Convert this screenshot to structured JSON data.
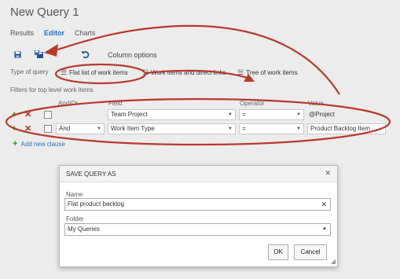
{
  "window": {
    "title": "New Query 1"
  },
  "tabs": [
    {
      "label": "Results"
    },
    {
      "label": "Editor",
      "active": true
    },
    {
      "label": "Charts"
    }
  ],
  "toolbar": {
    "column_options_label": "Column options"
  },
  "query_type": {
    "label": "Type of query",
    "options": [
      {
        "label": "Flat list of work items",
        "selected": true
      },
      {
        "label": "Work items and direct links"
      },
      {
        "label": "Tree of work items"
      }
    ]
  },
  "filters": {
    "title": "Filters for top level work items",
    "headers": {
      "andor": "And/Or",
      "field": "Field",
      "operator": "Operator",
      "value": "Value"
    },
    "rows": [
      {
        "andor": "",
        "field": "Team Project",
        "operator": "=",
        "value": "@Project"
      },
      {
        "andor": "And",
        "field": "Work Item Type",
        "operator": "=",
        "value": "Product Backlog Item"
      }
    ],
    "add_clause_label": "Add new clause"
  },
  "dialog": {
    "title": "SAVE QUERY AS",
    "name_label": "Name",
    "name_value": "Flat product backlog",
    "folder_label": "Folder",
    "folder_value": "My Queries",
    "ok_label": "OK",
    "cancel_label": "Cancel"
  },
  "colors": {
    "accent": "#1e74c6",
    "annotation": "#b83a2a",
    "add_green": "#2a9a2a",
    "delete_red": "#c42a1c"
  }
}
